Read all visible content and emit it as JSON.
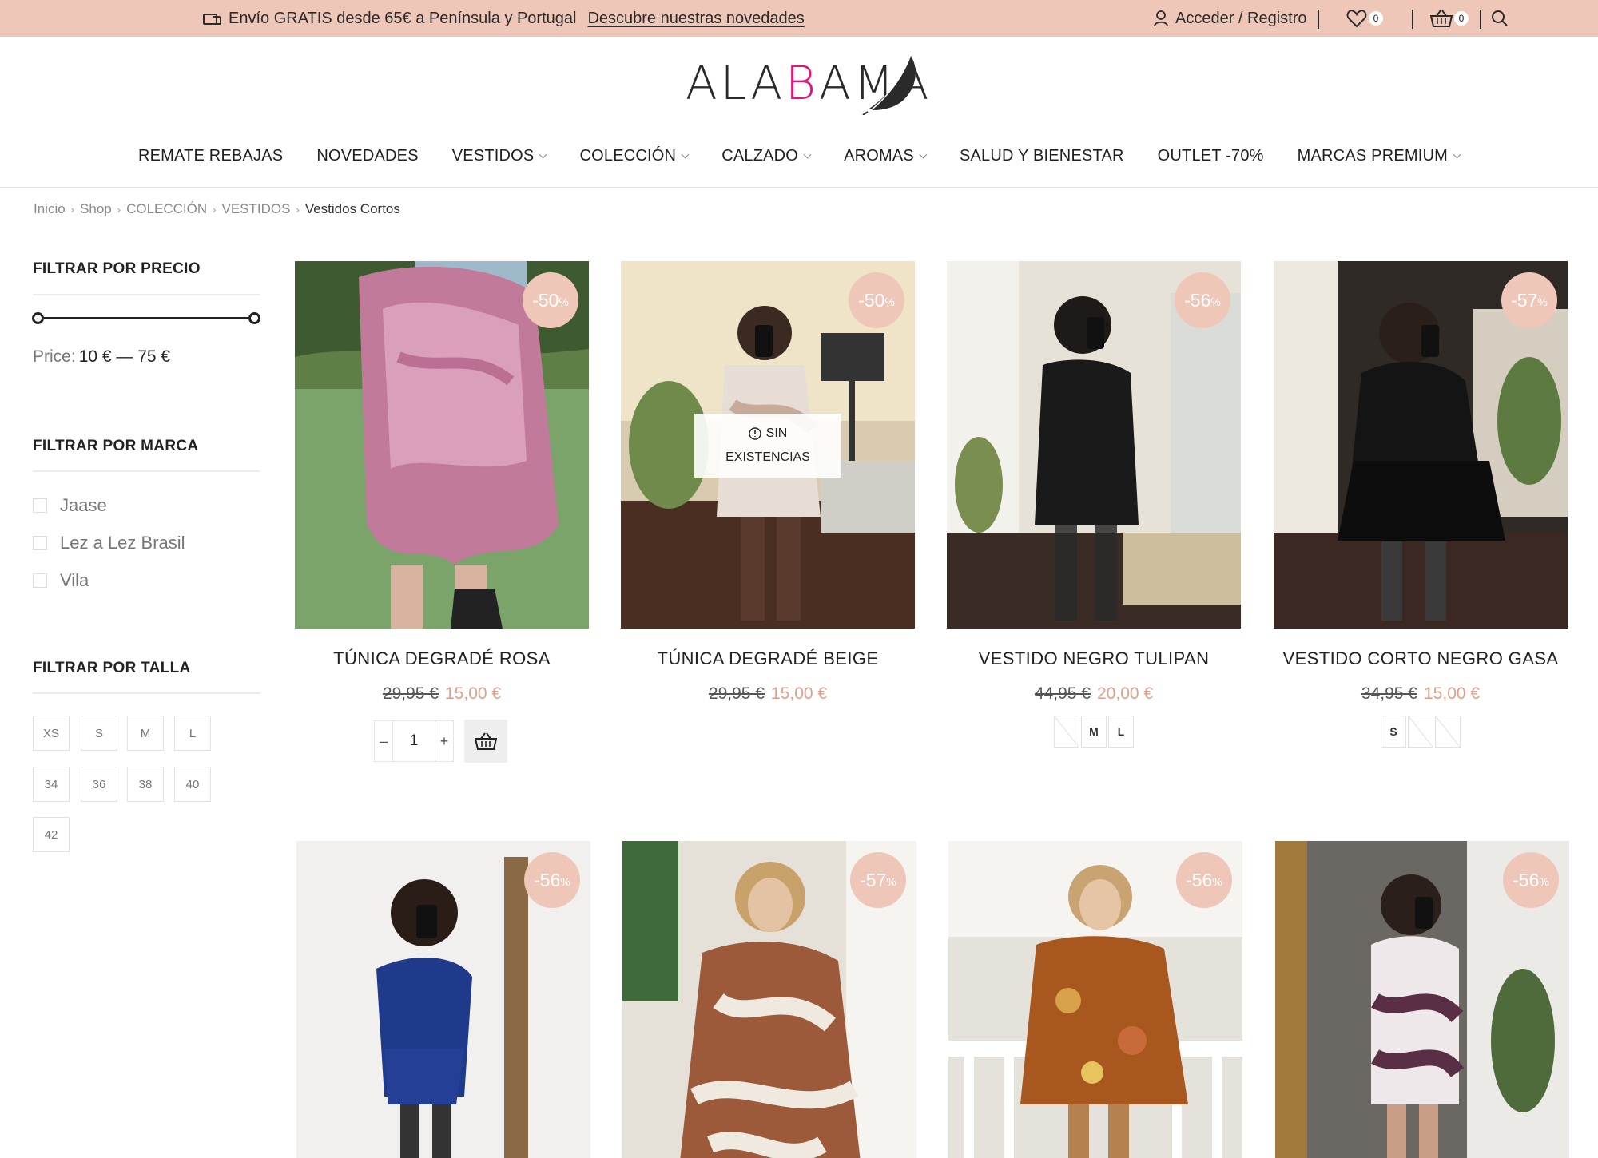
{
  "topbar": {
    "promo_text": "Envío GRATIS desde 65€ a Península y Portugal",
    "promo_link": "Descubre nuestras novedades",
    "account": "Acceder / Registro",
    "wishlist_count": "0",
    "cart_count": "0"
  },
  "logo": {
    "part1": "ALA",
    "part2": "B",
    "part3": "AMA"
  },
  "nav": [
    {
      "label": "REMATE REBAJAS",
      "has_dropdown": false
    },
    {
      "label": "NOVEDADES",
      "has_dropdown": false
    },
    {
      "label": "VESTIDOS",
      "has_dropdown": true
    },
    {
      "label": "COLECCIÓN",
      "has_dropdown": true
    },
    {
      "label": "CALZADO",
      "has_dropdown": true
    },
    {
      "label": "AROMAS",
      "has_dropdown": true
    },
    {
      "label": "SALUD Y BIENESTAR",
      "has_dropdown": false
    },
    {
      "label": "OUTLET -70%",
      "has_dropdown": false
    },
    {
      "label": "MARCAS PREMIUM",
      "has_dropdown": true
    }
  ],
  "breadcrumb": [
    "Inicio",
    "Shop",
    "COLECCIÓN",
    "VESTIDOS",
    "Vestidos Cortos"
  ],
  "sidebar": {
    "price_title": "FILTRAR POR PRECIO",
    "price_label": "Price:",
    "price_value": "10 € — 75 €",
    "brand_title": "FILTRAR POR MARCA",
    "brands": [
      "Jaase",
      "Lez a Lez Brasil",
      "Vila"
    ],
    "size_title": "FILTRAR POR TALLA",
    "sizes": [
      "XS",
      "S",
      "M",
      "L",
      "34",
      "36",
      "38",
      "40",
      "42"
    ]
  },
  "products": [
    {
      "name": "TÚNICA DEGRADÉ ROSA",
      "old_price": "29,95 €",
      "new_price": "15,00 €",
      "discount": "-50",
      "qty": "1"
    },
    {
      "name": "TÚNICA DEGRADÉ BEIGE",
      "old_price": "29,95 €",
      "new_price": "15,00 €",
      "discount": "-50",
      "stock_line1": "SIN",
      "stock_line2": "EXISTENCIAS"
    },
    {
      "name": "VESTIDO NEGRO TULIPAN",
      "old_price": "44,95 €",
      "new_price": "20,00 €",
      "discount": "-56",
      "swatches": [
        "",
        "M",
        "L"
      ]
    },
    {
      "name": "VESTIDO CORTO NEGRO GASA",
      "old_price": "34,95 €",
      "new_price": "15,00 €",
      "discount": "-57",
      "swatches": [
        "S",
        "",
        ""
      ]
    },
    {
      "discount": "-56"
    },
    {
      "discount": "-57"
    },
    {
      "discount": "-56"
    },
    {
      "discount": "-56"
    }
  ],
  "percent_sign": "%",
  "qty_minus": "–",
  "qty_plus": "+",
  "colors": {
    "topbar": "#efc7b8",
    "accent_pink": "#e0157a",
    "sale_price": "#e0a08a"
  }
}
